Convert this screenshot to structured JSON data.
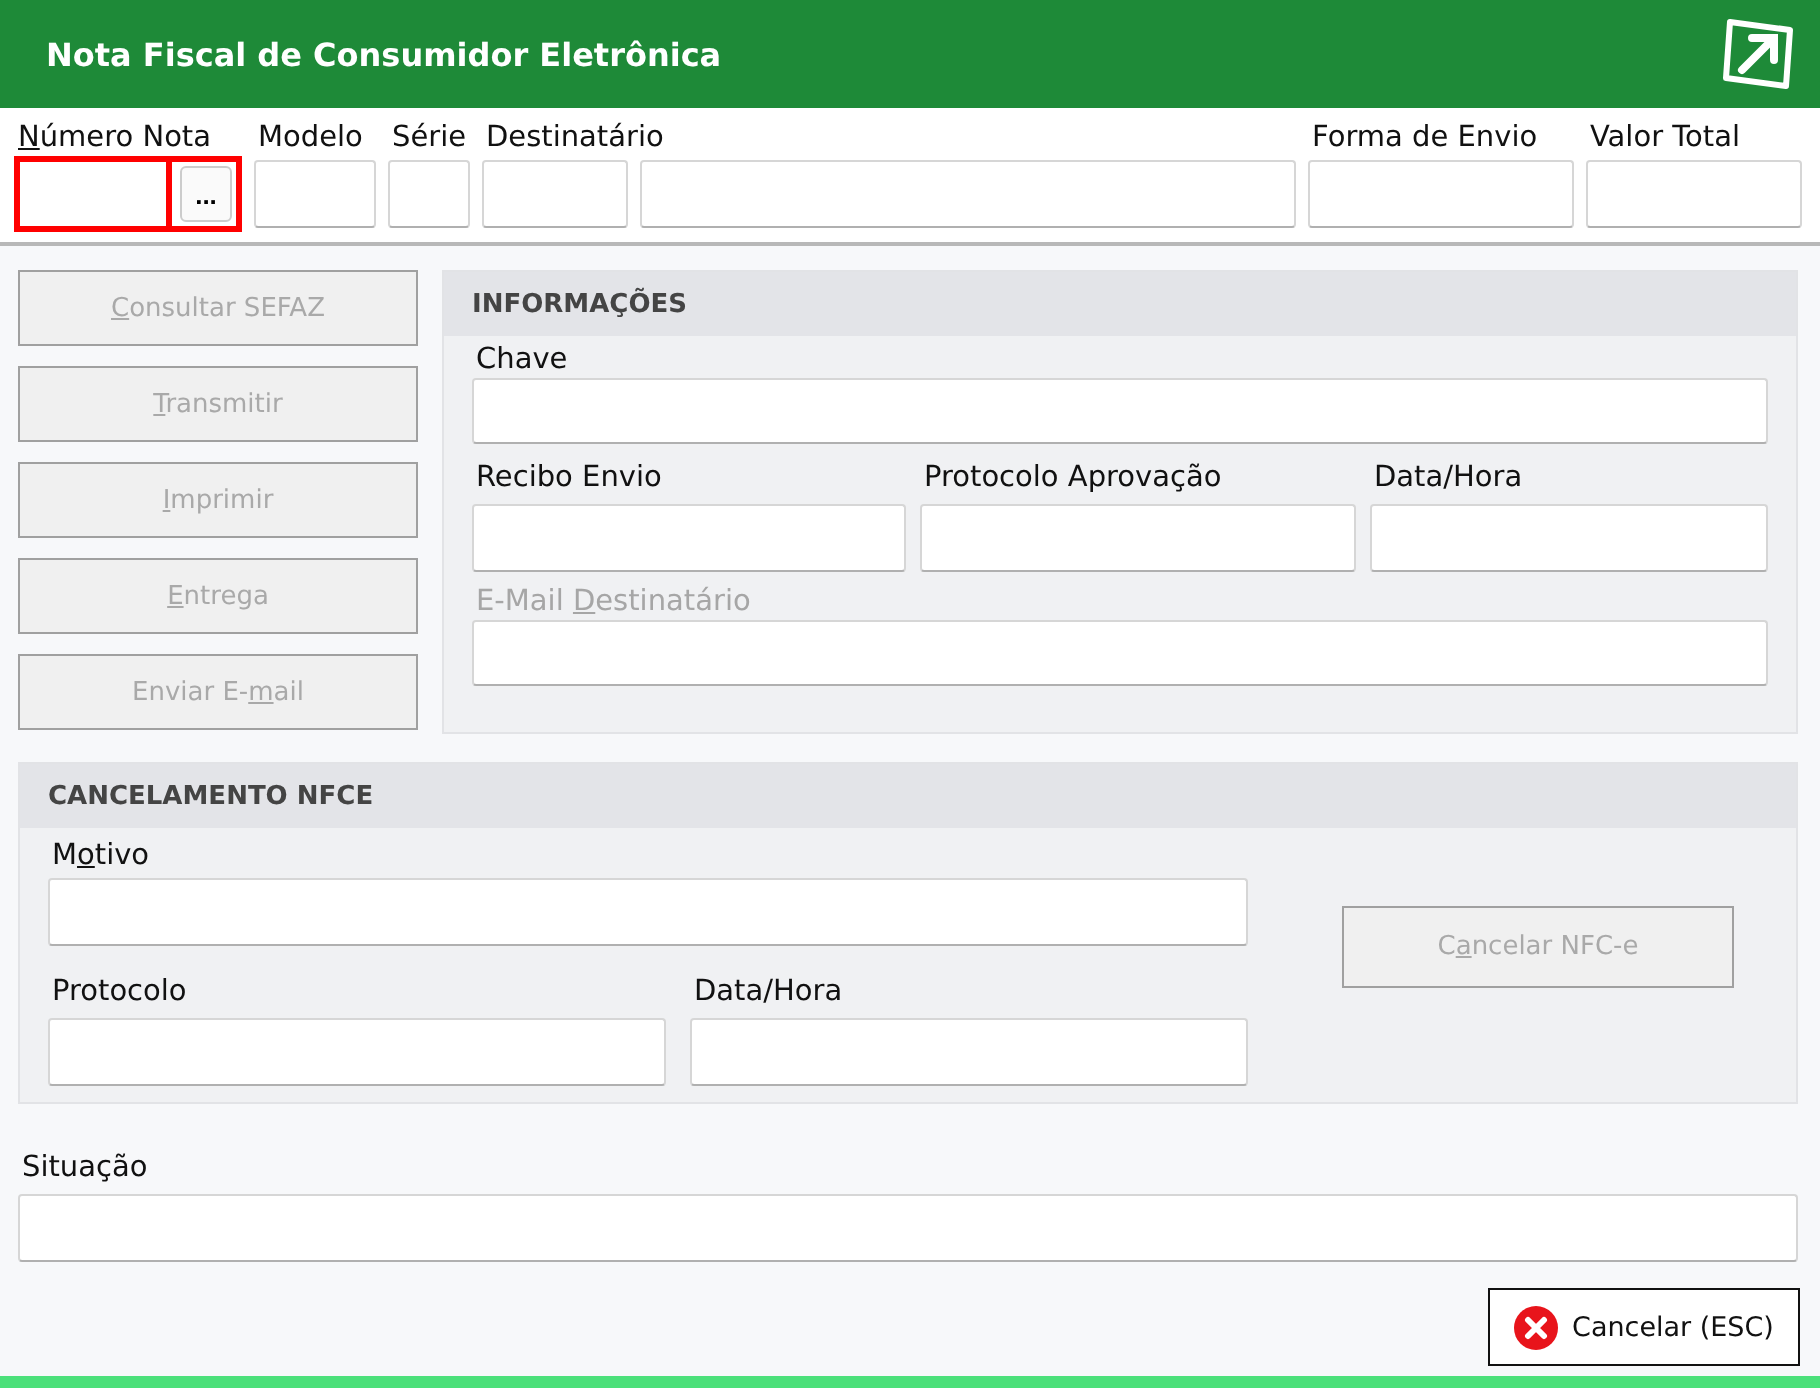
{
  "window": {
    "title": "Nota Fiscal de Consumidor Eletrônica"
  },
  "header_fields": [
    {
      "label": {
        "key": "N",
        "post": "úmero Nota"
      },
      "focused": true,
      "lookup_button": "..."
    },
    {
      "label": "Modelo",
      "focused": false
    },
    {
      "label": "Série",
      "focused": false
    },
    {
      "label": "Destinatário",
      "focused": false
    },
    {
      "focused": false
    },
    {
      "label": "Forma de Envio",
      "focused": false
    },
    {
      "label": "Valor Total",
      "focused": false
    }
  ],
  "actions": [
    {
      "label": {
        "key": "C",
        "post": "onsultar SEFAZ"
      },
      "disabled": true
    },
    {
      "label": {
        "key": "T",
        "post": "ransmitir"
      },
      "disabled": true
    },
    {
      "label": {
        "key": "I",
        "post": "mprimir"
      },
      "disabled": true
    },
    {
      "label": {
        "key": "E",
        "post": "ntrega"
      },
      "disabled": true
    },
    {
      "label": {
        "pre": "Enviar E-",
        "key": "m",
        "post": "ail"
      },
      "disabled": true
    }
  ],
  "informacoes": {
    "title": "INFORMAÇÕES",
    "chave": {
      "label": "Chave",
      "disabled": false
    },
    "row": [
      {
        "label": "Recibo Envio",
        "disabled": false
      },
      {
        "label": "Protocolo Aprovação",
        "disabled": false
      },
      {
        "label": "Data/Hora",
        "disabled": false
      }
    ],
    "email": {
      "label": {
        "pre": "E-Mail ",
        "key": "D",
        "post": "estinatário"
      },
      "disabled": true
    }
  },
  "cancelamento": {
    "title": "CANCELAMENTO NFCE",
    "motivo": {
      "label": {
        "pre": "M",
        "key": "o",
        "post": "tivo"
      }
    },
    "protocolo": {
      "label": "Protocolo"
    },
    "data_hora": {
      "label": "Data/Hora"
    },
    "button": {
      "label": {
        "pre": "C",
        "key": "a",
        "post": "ncelar NFC-e"
      },
      "disabled": true
    }
  },
  "situacao": {
    "label": "Situação"
  },
  "close_button": {
    "label": "Cancelar (ESC)"
  }
}
